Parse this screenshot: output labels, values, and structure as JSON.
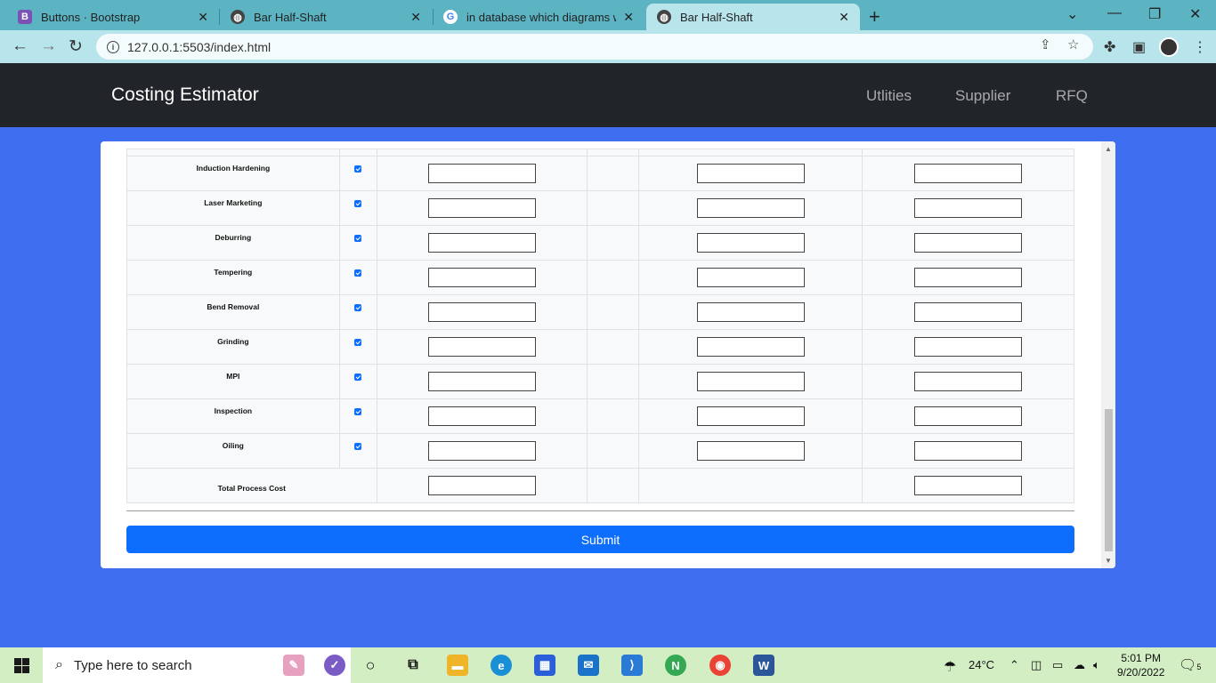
{
  "browser": {
    "tabs": [
      {
        "title": "Buttons · Bootstrap",
        "icon": "bootstrap-icon",
        "active": false
      },
      {
        "title": "Bar Half-Shaft",
        "icon": "globe-icon",
        "active": false
      },
      {
        "title": "in database which diagrams we w",
        "icon": "google-icon",
        "active": false
      },
      {
        "title": "Bar Half-Shaft",
        "icon": "globe-icon",
        "active": true
      }
    ],
    "new_tab": "+",
    "url": "127.0.0.1:5503/index.html"
  },
  "navbar": {
    "brand": "Costing Estimator",
    "links": [
      "Utlities",
      "Supplier",
      "RFQ"
    ]
  },
  "processes": {
    "rows": [
      {
        "name": "Induction Hardening",
        "checked": true
      },
      {
        "name": "Laser Marketing",
        "checked": true
      },
      {
        "name": "Deburring",
        "checked": true
      },
      {
        "name": "Tempering",
        "checked": true
      },
      {
        "name": "Bend Removal",
        "checked": true
      },
      {
        "name": "Grinding",
        "checked": true
      },
      {
        "name": "MPI",
        "checked": true
      },
      {
        "name": "Inspection",
        "checked": true
      },
      {
        "name": "Oiling",
        "checked": true
      }
    ],
    "total_label": "Total Process Cost"
  },
  "form": {
    "submit_label": "Submit"
  },
  "taskbar": {
    "search_placeholder": "Type here to search",
    "weather": "24°C",
    "time": "5:01 PM",
    "date": "9/20/2022",
    "notification_count": "5"
  },
  "colors": {
    "page_bg": "#3f6ef0",
    "navbar_bg": "#212529",
    "primary": "#0d6efd",
    "tabstrip": "#5cb3c2",
    "taskbar": "#d4eec4"
  }
}
